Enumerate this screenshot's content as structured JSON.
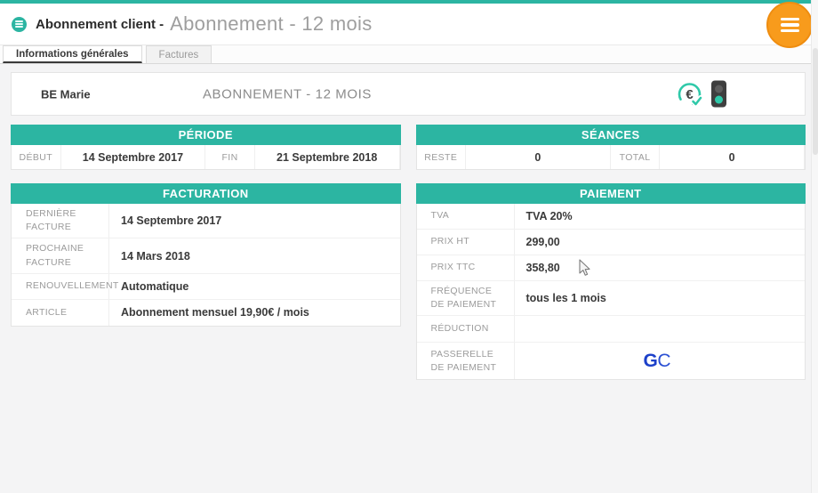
{
  "colors": {
    "accent_teal": "#2cb5a2",
    "fab_orange": "#f89b1c",
    "gateway_blue": "#1c40c9",
    "active_lamp": "#2fc9a9"
  },
  "header": {
    "title_bold": "Abonnement client -",
    "title_light": "Abonnement - 12 mois"
  },
  "tabs": [
    {
      "label": "Informations générales",
      "active": true
    },
    {
      "label": "Factures",
      "active": false
    }
  ],
  "client_bar": {
    "name": "BE Marie",
    "subscription_title": "ABONNEMENT - 12 MOIS",
    "icons": [
      "euro-paid-icon",
      "traffic-light-icon"
    ]
  },
  "tables": {
    "periode": {
      "title": "PÉRIODE",
      "cells": [
        {
          "label": "DÉBUT",
          "value": "14 Septembre 2017"
        },
        {
          "label": "FIN",
          "value": "21 Septembre 2018"
        }
      ]
    },
    "seances": {
      "title": "SÉANCES",
      "cells": [
        {
          "label": "RESTE",
          "value": "0"
        },
        {
          "label": "TOTAL",
          "value": "0"
        }
      ]
    },
    "facturation": {
      "title": "FACTURATION",
      "rows": [
        {
          "label": "DERNIÈRE FACTURE",
          "value": "14 Septembre 2017"
        },
        {
          "label": "PROCHAINE FACTURE",
          "value": "14 Mars 2018"
        },
        {
          "label": "RENOUVELLEMENT",
          "value": "Automatique"
        },
        {
          "label": "ARTICLE",
          "value": "Abonnement mensuel 19,90€ / mois"
        }
      ]
    },
    "paiement": {
      "title": "PAIEMENT",
      "rows": [
        {
          "label": "TVA",
          "value": "TVA 20%"
        },
        {
          "label": "PRIX HT",
          "value": "299,00"
        },
        {
          "label": "PRIX TTC",
          "value": "358,80"
        },
        {
          "label": "FRÉQUENCE DE PAIEMENT",
          "value": "tous les 1 mois"
        },
        {
          "label": "RÉDUCTION",
          "value": ""
        },
        {
          "label": "PASSERELLE DE PAIEMENT",
          "value": "",
          "gateway_logo": {
            "g": "G",
            "c": "C"
          }
        }
      ]
    }
  }
}
